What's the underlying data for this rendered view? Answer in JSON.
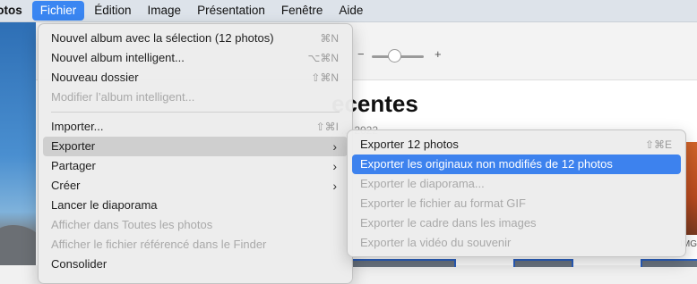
{
  "menubar": {
    "app": "hotos",
    "items": [
      "Fichier",
      "Édition",
      "Image",
      "Présentation",
      "Fenêtre",
      "Aide"
    ],
    "active": "Fichier"
  },
  "background": {
    "page_title": "ecentes",
    "page_subtitle": "… 2022",
    "right_label": "IMG"
  },
  "file_menu": {
    "items": [
      {
        "label": "Nouvel album avec la sélection (12 photos)",
        "shortcut": "⌘N",
        "enabled": true
      },
      {
        "label": "Nouvel album intelligent...",
        "shortcut": "⌥⌘N",
        "enabled": true
      },
      {
        "label": "Nouveau dossier",
        "shortcut": "⇧⌘N",
        "enabled": true
      },
      {
        "label": "Modifier l’album intelligent...",
        "shortcut": "",
        "enabled": false
      },
      {
        "label": "Importer...",
        "shortcut": "⇧⌘I",
        "enabled": true
      },
      {
        "label": "Exporter",
        "submenu": true,
        "enabled": true,
        "highlighted": true
      },
      {
        "label": "Partager",
        "submenu": true,
        "enabled": true
      },
      {
        "label": "Créer",
        "submenu": true,
        "enabled": true
      },
      {
        "label": "Lancer le diaporama",
        "enabled": true
      },
      {
        "label": "Afficher dans Toutes les photos",
        "enabled": false
      },
      {
        "label": "Afficher le fichier référencé dans le Finder",
        "enabled": false
      },
      {
        "label": "Consolider",
        "enabled": true
      }
    ]
  },
  "export_submenu": {
    "items": [
      {
        "label": "Exporter 12 photos",
        "shortcut": "⇧⌘E",
        "enabled": true
      },
      {
        "label": "Exporter les originaux non modifiés de 12 photos",
        "enabled": true,
        "selected": true
      },
      {
        "label": "Exporter le diaporama...",
        "enabled": false
      },
      {
        "label": "Exporter le fichier au format GIF",
        "enabled": false
      },
      {
        "label": "Exporter le cadre dans les images",
        "enabled": false
      },
      {
        "label": "Exporter la vidéo du souvenir",
        "enabled": false
      }
    ]
  },
  "colors": {
    "accent": "#3d82ee",
    "menubar": "#dde3ea"
  }
}
